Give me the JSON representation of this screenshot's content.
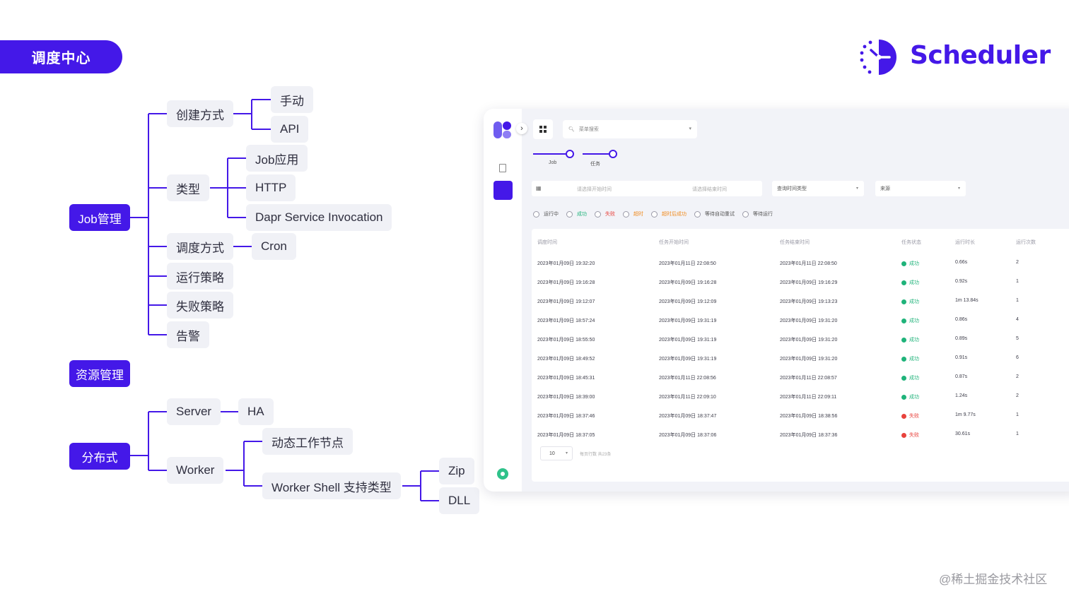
{
  "header": {
    "badge": "调度中心",
    "logo_text": "Scheduler",
    "accent": "#4418e8"
  },
  "tree": {
    "job_root": "Job管理",
    "resource_root": "资源管理",
    "dist_root": "分布式",
    "create_mode": "创建方式",
    "manual": "手动",
    "api": "API",
    "type": "类型",
    "job_app": "Job应用",
    "http": "HTTP",
    "dapr": "Dapr Service Invocation",
    "schedule_mode": "调度方式",
    "cron": "Cron",
    "run_policy": "运行策略",
    "fail_policy": "失败策略",
    "alarm": "告警",
    "server": "Server",
    "ha": "HA",
    "worker": "Worker",
    "dyn_node": "动态工作节点",
    "shell_types": "Worker Shell 支持类型",
    "zip": "Zip",
    "dll": "DLL"
  },
  "panel": {
    "search_placeholder": "菜单搜索",
    "slider_labels": [
      "Job",
      "任务"
    ],
    "filters": {
      "start_placeholder": "请选择开始时间",
      "end_placeholder": "请选择结束时间",
      "time_type": "查询时间类型",
      "source": "来源"
    },
    "radios": [
      {
        "label": "运行中",
        "color": "#555555"
      },
      {
        "label": "成功",
        "color": "#1fb37a"
      },
      {
        "label": "失败",
        "color": "#e8423c"
      },
      {
        "label": "超时",
        "color": "#f08a1c"
      },
      {
        "label": "超时后成功",
        "color": "#f08a1c"
      },
      {
        "label": "等待自动重试",
        "color": "#555555"
      },
      {
        "label": "等待运行",
        "color": "#555555"
      }
    ],
    "columns": [
      "调度时间",
      "任务开始时间",
      "任务结束时间",
      "任务状态",
      "运行时长",
      "运行次数"
    ],
    "rows": [
      [
        "2023年01月09日 19:32:20",
        "2023年01月11日 22:08:50",
        "2023年01月11日 22:08:50",
        "成功",
        "0.66s",
        "2"
      ],
      [
        "2023年01月09日 19:16:28",
        "2023年01月09日 19:16:28",
        "2023年01月09日 19:16:29",
        "成功",
        "0.92s",
        "1"
      ],
      [
        "2023年01月09日 19:12:07",
        "2023年01月09日 19:12:09",
        "2023年01月09日 19:13:23",
        "成功",
        "1m 13.84s",
        "1"
      ],
      [
        "2023年01月09日 18:57:24",
        "2023年01月09日 19:31:19",
        "2023年01月09日 19:31:20",
        "成功",
        "0.86s",
        "4"
      ],
      [
        "2023年01月09日 18:55:50",
        "2023年01月09日 19:31:19",
        "2023年01月09日 19:31:20",
        "成功",
        "0.89s",
        "5"
      ],
      [
        "2023年01月09日 18:49:52",
        "2023年01月09日 19:31:19",
        "2023年01月09日 19:31:20",
        "成功",
        "0.91s",
        "6"
      ],
      [
        "2023年01月09日 18:45:31",
        "2023年01月11日 22:08:56",
        "2023年01月11日 22:08:57",
        "成功",
        "0.87s",
        "2"
      ],
      [
        "2023年01月09日 18:39:00",
        "2023年01月11日 22:09:10",
        "2023年01月11日 22:09:11",
        "成功",
        "1.24s",
        "2"
      ],
      [
        "2023年01月09日 18:37:46",
        "2023年01月09日 18:37:47",
        "2023年01月09日 18:38:56",
        "失败",
        "1m 9.77s",
        "1"
      ],
      [
        "2023年01月09日 18:37:05",
        "2023年01月09日 18:37:06",
        "2023年01月09日 18:37:36",
        "失败",
        "30.61s",
        "1"
      ]
    ],
    "status_colors": {
      "成功": "#1fb37a",
      "失败": "#e8423c"
    },
    "page_size": "10",
    "pager_info": "每页行数  共23条"
  },
  "watermark": "@稀土掘金技术社区"
}
